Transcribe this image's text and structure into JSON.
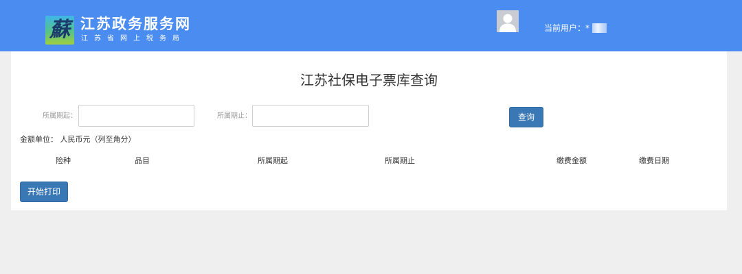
{
  "header": {
    "logo_glyph": "蘇",
    "title": "江苏政务服务网",
    "subtitle": "江苏省网上税务局",
    "user_label": "当前用户：",
    "user_value": "*"
  },
  "page": {
    "title": "江苏社保电子票库查询"
  },
  "form": {
    "start_label": "所属期起：",
    "start_value": "",
    "end_label": "所属期止：",
    "end_value": "",
    "query_button": "查询"
  },
  "unit_text": "金额单位： 人民币元（列至角分）",
  "table": {
    "columns": [
      "险种",
      "品目",
      "所属期起",
      "所属期止",
      "缴费金额",
      "缴费日期"
    ],
    "rows": []
  },
  "print_button": "开始打印",
  "colors": {
    "header_bg": "#4a8cef",
    "button_bg": "#3a78b5",
    "page_bg": "#efefef"
  }
}
